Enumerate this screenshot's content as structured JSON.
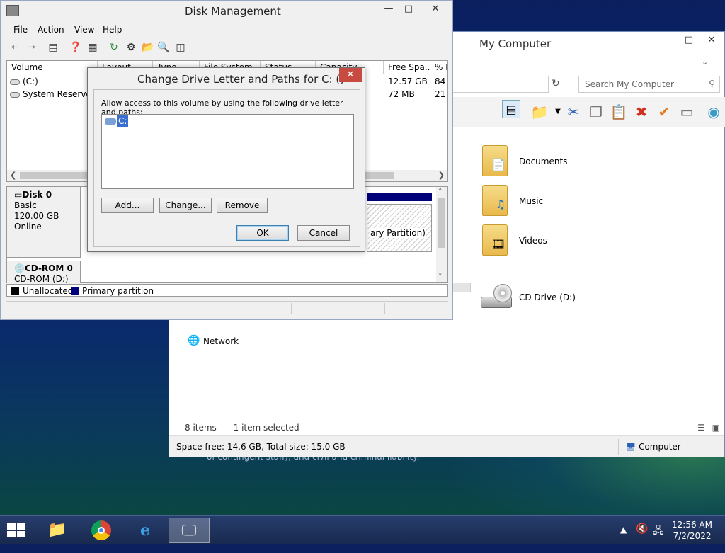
{
  "desktop": {
    "wallpaper_text": "of contingent staff), and civil and criminal liability."
  },
  "explorer": {
    "title": "My Computer",
    "search_placeholder": "Search My Computer",
    "items": [
      {
        "label": "Documents",
        "icon": "documents-folder-icon"
      },
      {
        "label": "Music",
        "icon": "music-folder-icon"
      },
      {
        "label": "Videos",
        "icon": "videos-folder-icon"
      },
      {
        "label": "CD Drive (D:)",
        "icon": "cd-drive-icon"
      },
      {
        "label": "Network",
        "icon": "network-icon"
      }
    ],
    "item_count": "8 items",
    "selection": "1 item selected",
    "status_space": "Space free: 14.6 GB, Total size: 15.0 GB",
    "status_location": "Computer"
  },
  "diskmgmt": {
    "title": "Disk Management",
    "menu": [
      "File",
      "Action",
      "View",
      "Help"
    ],
    "columns": [
      "Volume",
      "Layout",
      "Type",
      "File System",
      "Status",
      "Capacity",
      "Free Spa...",
      "% F"
    ],
    "volumes": [
      {
        "name": "(C:)",
        "free": "12.57 GB",
        "pct": "84"
      },
      {
        "name": "System Reserved",
        "free": "72 MB",
        "pct": "21"
      }
    ],
    "disks": [
      {
        "name": "Disk 0",
        "type": "Basic",
        "size": "120.00 GB",
        "status": "Online"
      },
      {
        "name": "CD-ROM 0",
        "type": "CD-ROM (D:)"
      }
    ],
    "partition_text": "ary Partition)",
    "legend": [
      "Unallocated",
      "Primary partition"
    ],
    "colors": {
      "unallocated": "#000000",
      "primary": "#00007a"
    }
  },
  "dialog": {
    "title": "Change Drive Letter and Paths for C: ()",
    "description": "Allow access to this volume by using the following drive letter and paths:",
    "paths": [
      "C:"
    ],
    "buttons": {
      "add": "Add...",
      "change": "Change...",
      "remove": "Remove",
      "ok": "OK",
      "cancel": "Cancel"
    }
  },
  "taskbar": {
    "time": "12:56 AM",
    "date": "7/2/2022"
  }
}
